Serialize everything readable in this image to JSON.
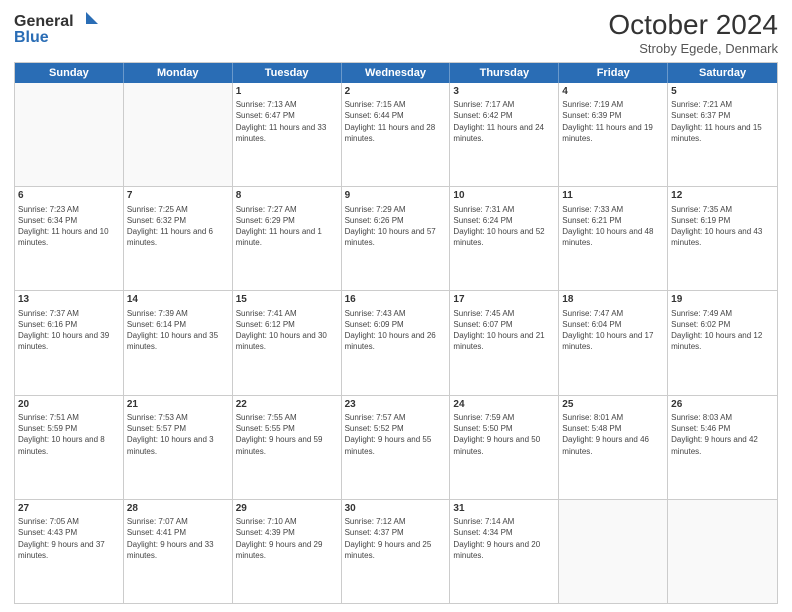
{
  "header": {
    "logo_line1": "General",
    "logo_line2": "Blue",
    "month": "October 2024",
    "location": "Stroby Egede, Denmark"
  },
  "day_names": [
    "Sunday",
    "Monday",
    "Tuesday",
    "Wednesday",
    "Thursday",
    "Friday",
    "Saturday"
  ],
  "weeks": [
    [
      {
        "day": "",
        "sunrise": "",
        "sunset": "",
        "daylight": "",
        "empty": true
      },
      {
        "day": "",
        "sunrise": "",
        "sunset": "",
        "daylight": "",
        "empty": true
      },
      {
        "day": "1",
        "sunrise": "Sunrise: 7:13 AM",
        "sunset": "Sunset: 6:47 PM",
        "daylight": "Daylight: 11 hours and 33 minutes.",
        "empty": false
      },
      {
        "day": "2",
        "sunrise": "Sunrise: 7:15 AM",
        "sunset": "Sunset: 6:44 PM",
        "daylight": "Daylight: 11 hours and 28 minutes.",
        "empty": false
      },
      {
        "day": "3",
        "sunrise": "Sunrise: 7:17 AM",
        "sunset": "Sunset: 6:42 PM",
        "daylight": "Daylight: 11 hours and 24 minutes.",
        "empty": false
      },
      {
        "day": "4",
        "sunrise": "Sunrise: 7:19 AM",
        "sunset": "Sunset: 6:39 PM",
        "daylight": "Daylight: 11 hours and 19 minutes.",
        "empty": false
      },
      {
        "day": "5",
        "sunrise": "Sunrise: 7:21 AM",
        "sunset": "Sunset: 6:37 PM",
        "daylight": "Daylight: 11 hours and 15 minutes.",
        "empty": false
      }
    ],
    [
      {
        "day": "6",
        "sunrise": "Sunrise: 7:23 AM",
        "sunset": "Sunset: 6:34 PM",
        "daylight": "Daylight: 11 hours and 10 minutes.",
        "empty": false
      },
      {
        "day": "7",
        "sunrise": "Sunrise: 7:25 AM",
        "sunset": "Sunset: 6:32 PM",
        "daylight": "Daylight: 11 hours and 6 minutes.",
        "empty": false
      },
      {
        "day": "8",
        "sunrise": "Sunrise: 7:27 AM",
        "sunset": "Sunset: 6:29 PM",
        "daylight": "Daylight: 11 hours and 1 minute.",
        "empty": false
      },
      {
        "day": "9",
        "sunrise": "Sunrise: 7:29 AM",
        "sunset": "Sunset: 6:26 PM",
        "daylight": "Daylight: 10 hours and 57 minutes.",
        "empty": false
      },
      {
        "day": "10",
        "sunrise": "Sunrise: 7:31 AM",
        "sunset": "Sunset: 6:24 PM",
        "daylight": "Daylight: 10 hours and 52 minutes.",
        "empty": false
      },
      {
        "day": "11",
        "sunrise": "Sunrise: 7:33 AM",
        "sunset": "Sunset: 6:21 PM",
        "daylight": "Daylight: 10 hours and 48 minutes.",
        "empty": false
      },
      {
        "day": "12",
        "sunrise": "Sunrise: 7:35 AM",
        "sunset": "Sunset: 6:19 PM",
        "daylight": "Daylight: 10 hours and 43 minutes.",
        "empty": false
      }
    ],
    [
      {
        "day": "13",
        "sunrise": "Sunrise: 7:37 AM",
        "sunset": "Sunset: 6:16 PM",
        "daylight": "Daylight: 10 hours and 39 minutes.",
        "empty": false
      },
      {
        "day": "14",
        "sunrise": "Sunrise: 7:39 AM",
        "sunset": "Sunset: 6:14 PM",
        "daylight": "Daylight: 10 hours and 35 minutes.",
        "empty": false
      },
      {
        "day": "15",
        "sunrise": "Sunrise: 7:41 AM",
        "sunset": "Sunset: 6:12 PM",
        "daylight": "Daylight: 10 hours and 30 minutes.",
        "empty": false
      },
      {
        "day": "16",
        "sunrise": "Sunrise: 7:43 AM",
        "sunset": "Sunset: 6:09 PM",
        "daylight": "Daylight: 10 hours and 26 minutes.",
        "empty": false
      },
      {
        "day": "17",
        "sunrise": "Sunrise: 7:45 AM",
        "sunset": "Sunset: 6:07 PM",
        "daylight": "Daylight: 10 hours and 21 minutes.",
        "empty": false
      },
      {
        "day": "18",
        "sunrise": "Sunrise: 7:47 AM",
        "sunset": "Sunset: 6:04 PM",
        "daylight": "Daylight: 10 hours and 17 minutes.",
        "empty": false
      },
      {
        "day": "19",
        "sunrise": "Sunrise: 7:49 AM",
        "sunset": "Sunset: 6:02 PM",
        "daylight": "Daylight: 10 hours and 12 minutes.",
        "empty": false
      }
    ],
    [
      {
        "day": "20",
        "sunrise": "Sunrise: 7:51 AM",
        "sunset": "Sunset: 5:59 PM",
        "daylight": "Daylight: 10 hours and 8 minutes.",
        "empty": false
      },
      {
        "day": "21",
        "sunrise": "Sunrise: 7:53 AM",
        "sunset": "Sunset: 5:57 PM",
        "daylight": "Daylight: 10 hours and 3 minutes.",
        "empty": false
      },
      {
        "day": "22",
        "sunrise": "Sunrise: 7:55 AM",
        "sunset": "Sunset: 5:55 PM",
        "daylight": "Daylight: 9 hours and 59 minutes.",
        "empty": false
      },
      {
        "day": "23",
        "sunrise": "Sunrise: 7:57 AM",
        "sunset": "Sunset: 5:52 PM",
        "daylight": "Daylight: 9 hours and 55 minutes.",
        "empty": false
      },
      {
        "day": "24",
        "sunrise": "Sunrise: 7:59 AM",
        "sunset": "Sunset: 5:50 PM",
        "daylight": "Daylight: 9 hours and 50 minutes.",
        "empty": false
      },
      {
        "day": "25",
        "sunrise": "Sunrise: 8:01 AM",
        "sunset": "Sunset: 5:48 PM",
        "daylight": "Daylight: 9 hours and 46 minutes.",
        "empty": false
      },
      {
        "day": "26",
        "sunrise": "Sunrise: 8:03 AM",
        "sunset": "Sunset: 5:46 PM",
        "daylight": "Daylight: 9 hours and 42 minutes.",
        "empty": false
      }
    ],
    [
      {
        "day": "27",
        "sunrise": "Sunrise: 7:05 AM",
        "sunset": "Sunset: 4:43 PM",
        "daylight": "Daylight: 9 hours and 37 minutes.",
        "empty": false
      },
      {
        "day": "28",
        "sunrise": "Sunrise: 7:07 AM",
        "sunset": "Sunset: 4:41 PM",
        "daylight": "Daylight: 9 hours and 33 minutes.",
        "empty": false
      },
      {
        "day": "29",
        "sunrise": "Sunrise: 7:10 AM",
        "sunset": "Sunset: 4:39 PM",
        "daylight": "Daylight: 9 hours and 29 minutes.",
        "empty": false
      },
      {
        "day": "30",
        "sunrise": "Sunrise: 7:12 AM",
        "sunset": "Sunset: 4:37 PM",
        "daylight": "Daylight: 9 hours and 25 minutes.",
        "empty": false
      },
      {
        "day": "31",
        "sunrise": "Sunrise: 7:14 AM",
        "sunset": "Sunset: 4:34 PM",
        "daylight": "Daylight: 9 hours and 20 minutes.",
        "empty": false
      },
      {
        "day": "",
        "sunrise": "",
        "sunset": "",
        "daylight": "",
        "empty": true
      },
      {
        "day": "",
        "sunrise": "",
        "sunset": "",
        "daylight": "",
        "empty": true
      }
    ]
  ]
}
